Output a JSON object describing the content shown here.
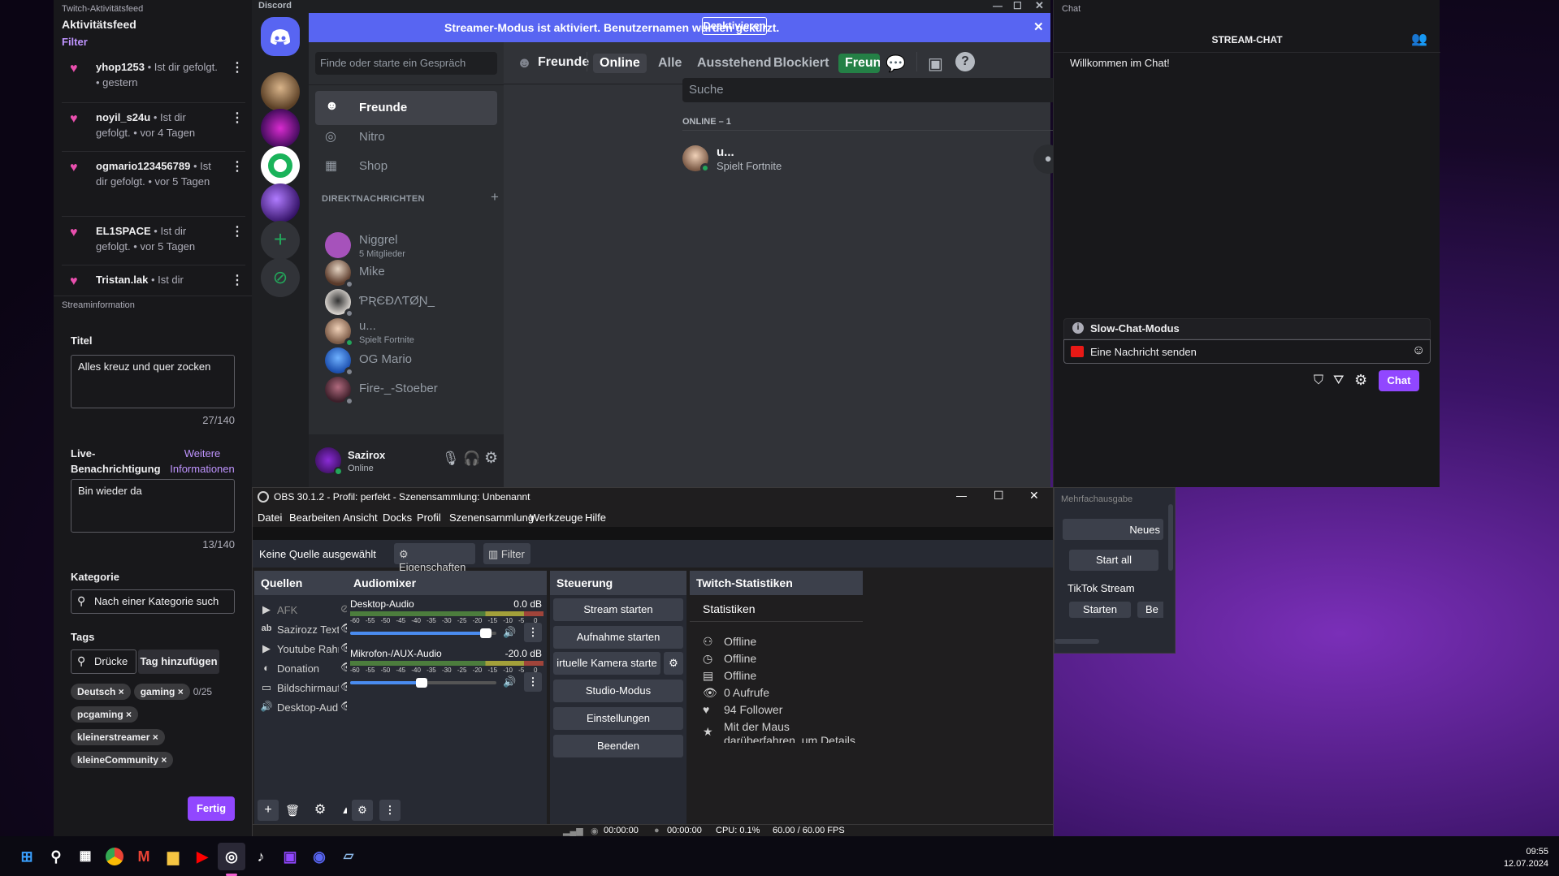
{
  "activity": {
    "window_title": "Twitch-Aktivitätsfeed",
    "heading": "Aktivitätsfeed",
    "filter_label": "Filter",
    "items": [
      {
        "user": "yhop1253",
        "action": "• Ist dir gefolgt.",
        "time": "• gestern"
      },
      {
        "user": "noyil_s24u",
        "action": "• Ist dir gefolgt.",
        "time": "• vor 4 Tagen"
      },
      {
        "user": "ogmario123456789",
        "action": "• Ist dir gefolgt.",
        "time": "• vor 5 Tagen"
      },
      {
        "user": "EL1SPACE",
        "action": "• Ist dir gefolgt.",
        "time": "• vor 5 Tagen"
      },
      {
        "user": "Tristan.lak",
        "action": "• Ist dir",
        "time": ""
      }
    ]
  },
  "streaminfo": {
    "window_title": "Streaminformation",
    "title_label": "Titel",
    "title_value": "Alles kreuz und quer zocken",
    "title_count": "27/140",
    "notif_label": "Live-Benachrichtigung",
    "more_info": "Weitere Informationen",
    "notif_value": "Bin wieder da",
    "notif_count": "13/140",
    "category_label": "Kategorie",
    "category_placeholder": "Nach einer Kategorie such",
    "tags_label": "Tags",
    "tags_placeholder": "Drücke",
    "add_tag": "Tag hinzufügen",
    "tag_count": "0/25",
    "tags": [
      "Deutsch ×",
      "gaming ×",
      "pcgaming ×",
      "kleinerstreamer ×",
      "kleineCommunity ×"
    ],
    "done": "Fertig"
  },
  "discord": {
    "app_title": "Discord",
    "banner_text": "Streamer-Modus ist aktiviert. Benutzernamen wurden gekürzt.",
    "banner_button": "Deaktivieren",
    "search_placeholder": "Finde oder starte ein Gespräch",
    "nav": [
      "Freunde",
      "Nitro",
      "Shop"
    ],
    "dm_header": "DIREKTNACHRICHTEN",
    "dms": [
      {
        "name": "Niggrel",
        "sub": "5 Mitglieder",
        "color": "#a652bb"
      },
      {
        "name": "Mike",
        "sub": "",
        "color": "#7a6a5c"
      },
      {
        "name": "ƤƦЄÐΛƬØƝ_",
        "sub": "",
        "color": "#d9d4cf"
      },
      {
        "name": "u...",
        "sub": "Spielt Fortnite",
        "color": "#b78e78"
      },
      {
        "name": "OG Mario",
        "sub": "",
        "color": "#2d6fd6"
      },
      {
        "name": "Fire-_-Stoeber",
        "sub": "",
        "color": "#6b3a4a"
      }
    ],
    "user": {
      "name": "Sazirox",
      "status": "Online"
    },
    "friends_header": "Freunde",
    "tabs": [
      "Online",
      "Alle",
      "Ausstehend",
      "Blockiert"
    ],
    "add_friend": "Freun",
    "search": "Suche",
    "online_count": "ONLINE – 1",
    "friend": {
      "name": "u...",
      "activity": "Spielt Fortnite"
    }
  },
  "chat": {
    "window_title": "Chat",
    "heading": "STREAM-CHAT",
    "welcome": "Willkommen im Chat!",
    "slow_mode": "Slow-Chat-Modus",
    "input_placeholder": "Eine Nachricht senden",
    "send": "Chat"
  },
  "obs": {
    "title": "OBS 30.1.2 - Profil: perfekt - Szenensammlung: Unbenannt",
    "menu": [
      "Datei",
      "Bearbeiten",
      "Ansicht",
      "Docks",
      "Profil",
      "Szenensammlung",
      "Werkzeuge",
      "Hilfe"
    ],
    "no_source": "Keine Quelle ausgewählt",
    "properties": "Eigenschaften",
    "filter": "Filter",
    "sources_title": "Quellen",
    "sources": [
      {
        "name": "AFK",
        "icon": "▶"
      },
      {
        "name": "Sazirozz Text",
        "icon": "ab"
      },
      {
        "name": "Youtube Rahm",
        "icon": "▶"
      },
      {
        "name": "Donation",
        "icon": "◐"
      },
      {
        "name": "Bildschirmaufn",
        "icon": "▭"
      },
      {
        "name": "Desktop-Audio",
        "icon": "🔊"
      }
    ],
    "mixer_title": "Audiomixer",
    "mixer": [
      {
        "name": "Desktop-Audio",
        "db": "0.0 dB",
        "level": 0.93
      },
      {
        "name": "Mikrofon-/AUX-Audio",
        "db": "-20.0 dB",
        "level": 0.49
      }
    ],
    "meter_ticks": [
      "-60",
      "-55",
      "-50",
      "-45",
      "-40",
      "-35",
      "-30",
      "-25",
      "-20",
      "-15",
      "-10",
      "-5",
      "0"
    ],
    "controls_title": "Steuerung",
    "controls": [
      "Stream starten",
      "Aufnahme starten",
      "irtuelle Kamera starte",
      "Studio-Modus",
      "Einstellungen",
      "Beenden"
    ],
    "stats_title": "Twitch-Statistiken",
    "stats_heading": "Statistiken",
    "stats": [
      "Offline",
      "Offline",
      "Offline",
      "0 Aufrufe",
      "94 Follower",
      "Mit der Maus darüberfahren, um Details anzuzeigen"
    ],
    "status": {
      "rec1": "00:00:00",
      "rec2": "00:00:00",
      "cpu": "CPU: 0.1%",
      "fps": "60.00 / 60.00 FPS"
    }
  },
  "multi": {
    "window_title": "Mehrfachausgabe",
    "new_btn": "Neues",
    "start_all": "Start all",
    "tiktok": "TikTok Stream",
    "start": "Starten",
    "b": "Be"
  },
  "taskbar": {
    "time": "09:55",
    "date": "12.07.2024"
  }
}
